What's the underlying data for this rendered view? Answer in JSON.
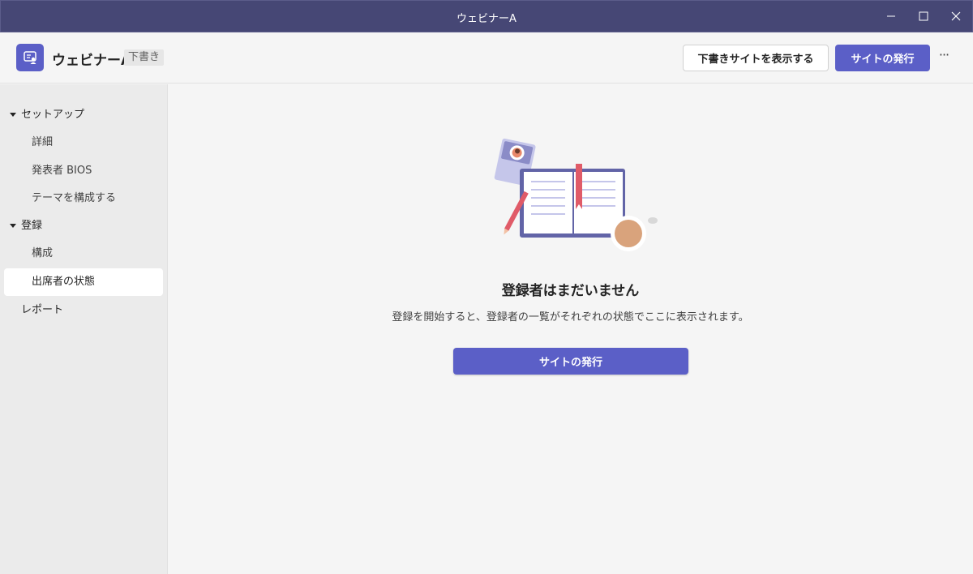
{
  "window": {
    "title": "ウェビナーA"
  },
  "header": {
    "app_title": "ウェビナーA",
    "status_badge": "下書き",
    "view_draft_label": "下書きサイトを表示する",
    "publish_label": "サイトの発行",
    "more_label": "···"
  },
  "sidebar": {
    "setup_label": "セットアップ",
    "setup_items": [
      "詳細",
      "発表者 BIOS",
      "テーマを構成する"
    ],
    "registration_label": "登録",
    "registration_items": [
      "構成",
      "出席者の状態"
    ],
    "report_label": "レポート",
    "selected": "出席者の状態"
  },
  "main": {
    "empty_title": "登録者はまだいません",
    "empty_description": "登録を開始すると、登録者の一覧がそれぞれの状態でここに表示されます。",
    "publish_label": "サイトの発行"
  },
  "colors": {
    "titlebar": "#464775",
    "accent": "#5b5fc7",
    "sidebar_bg": "#ebebeb",
    "main_bg": "#f5f5f5"
  }
}
